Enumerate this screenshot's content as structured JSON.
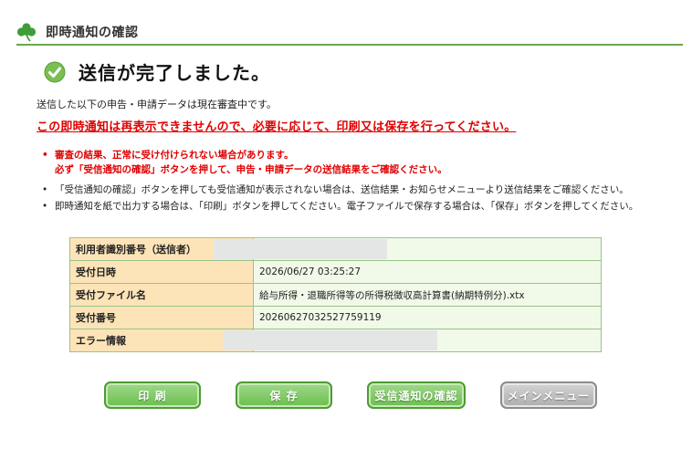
{
  "header": {
    "title": "即時通知の確認"
  },
  "status": {
    "message": "送信が完了しました。"
  },
  "sub_text": "送信した以下の申告・申請データは現在審査中です。",
  "warning": "この即時通知は再表示できませんので、必要に応じて、印刷又は保存を行ってください。",
  "notes": {
    "red_line1": "審査の結果、正常に受け付けられない場合があります。",
    "red_line2": "必ず「受信通知の確認」ボタンを押して、申告・申請データの送信結果をご確認ください。",
    "line2": "「受信通知の確認」ボタンを押しても受信通知が表示されない場合は、送信結果・お知らせメニューより送信結果をご確認ください。",
    "line3": "即時通知を紙で出力する場合は、「印刷」ボタンを押してください。電子ファイルで保存する場合は、「保存」ボタンを押してください。"
  },
  "table": {
    "rows": [
      {
        "label": "利用者識別番号（送信者）",
        "value": ""
      },
      {
        "label": "受付日時",
        "value": "2026/06/27 03:25:27"
      },
      {
        "label": "受付ファイル名",
        "value": "給与所得・退職所得等の所得税徴収高計算書(納期特例分).xtx"
      },
      {
        "label": "受付番号",
        "value": "20260627032527759119"
      },
      {
        "label": "エラー情報",
        "value": ""
      }
    ]
  },
  "buttons": {
    "print": "印 刷",
    "save": "保 存",
    "check_receipt": "受信通知の確認",
    "main_menu": "メインメニュー"
  },
  "colors": {
    "accent_green": "#6bbf4e",
    "warning_red": "#e00000",
    "label_bg": "#fde4b8",
    "value_bg": "#f1f9e8"
  }
}
